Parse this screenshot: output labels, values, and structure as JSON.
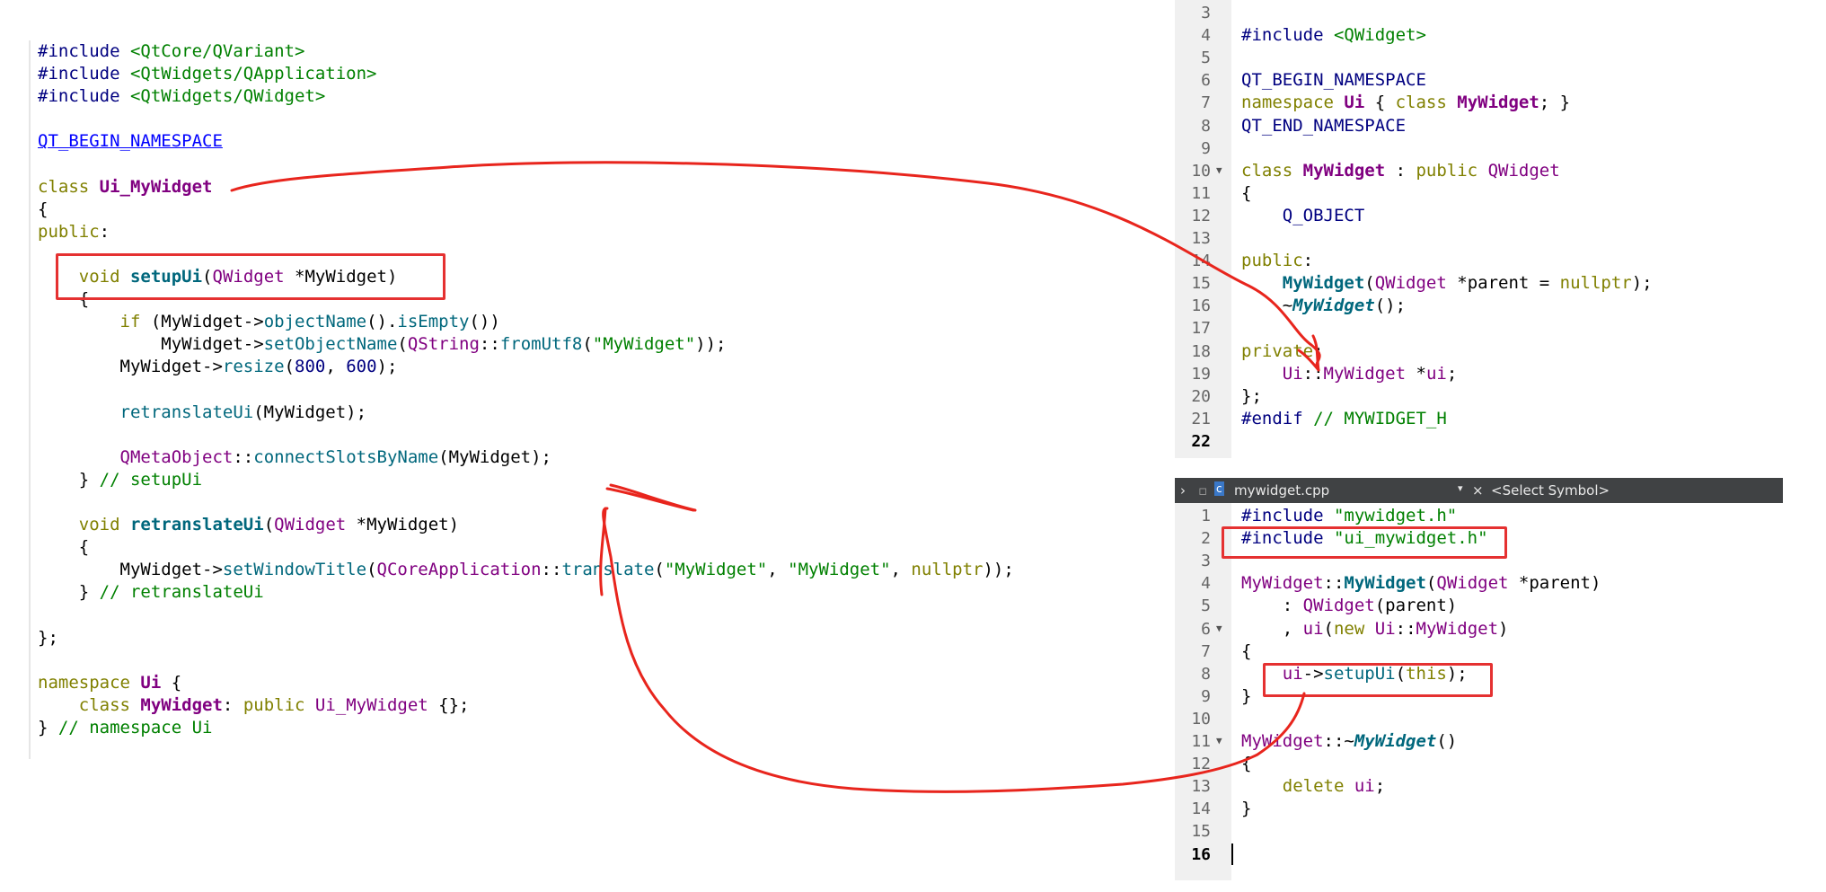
{
  "left_code": [
    [
      [
        "pp",
        "#include "
      ],
      [
        "str",
        "<QtCore/QVariant>"
      ]
    ],
    [
      [
        "pp",
        "#include "
      ],
      [
        "str",
        "<QtWidgets/QApplication>"
      ]
    ],
    [
      [
        "pp",
        "#include "
      ],
      [
        "str",
        "<QtWidgets/QWidget>"
      ]
    ],
    [],
    [
      [
        "link",
        "QT_BEGIN_NAMESPACE"
      ]
    ],
    [],
    [
      [
        "kw",
        "class "
      ],
      [
        "cls",
        "Ui_MyWidget"
      ]
    ],
    [
      [
        "",
        "{"
      ]
    ],
    [
      [
        "kw",
        "public"
      ],
      [
        "",
        ":"
      ]
    ],
    [],
    [
      [
        "",
        "    "
      ],
      [
        "kw",
        "void "
      ],
      [
        "def",
        "setupUi"
      ],
      [
        "",
        "("
      ],
      [
        "typ",
        "QWidget"
      ],
      [
        "",
        " *MyWidget)"
      ]
    ],
    [
      [
        "",
        "    {"
      ]
    ],
    [
      [
        "",
        "        "
      ],
      [
        "kw",
        "if "
      ],
      [
        "",
        "(MyWidget->"
      ],
      [
        "fn",
        "objectName"
      ],
      [
        "",
        "()."
      ],
      [
        "fn",
        "isEmpty"
      ],
      [
        "",
        "())"
      ]
    ],
    [
      [
        "",
        "            MyWidget->"
      ],
      [
        "fn",
        "setObjectName"
      ],
      [
        "",
        "("
      ],
      [
        "typ",
        "QString"
      ],
      [
        "",
        "::"
      ],
      [
        "fn",
        "fromUtf8"
      ],
      [
        "",
        "("
      ],
      [
        "str",
        "\"MyWidget\""
      ],
      [
        "",
        "));"
      ]
    ],
    [
      [
        "",
        "        MyWidget->"
      ],
      [
        "fn",
        "resize"
      ],
      [
        "",
        "("
      ],
      [
        "num",
        "800"
      ],
      [
        "",
        ", "
      ],
      [
        "num",
        "600"
      ],
      [
        "",
        ");"
      ]
    ],
    [],
    [
      [
        "",
        "        "
      ],
      [
        "fn",
        "retranslateUi"
      ],
      [
        "",
        "(MyWidget);"
      ]
    ],
    [],
    [
      [
        "",
        "        "
      ],
      [
        "typ",
        "QMetaObject"
      ],
      [
        "",
        "::"
      ],
      [
        "fn",
        "connectSlotsByName"
      ],
      [
        "",
        "(MyWidget);"
      ]
    ],
    [
      [
        "",
        "    } "
      ],
      [
        "cmt",
        "// setupUi"
      ]
    ],
    [],
    [
      [
        "",
        "    "
      ],
      [
        "kw",
        "void "
      ],
      [
        "def",
        "retranslateUi"
      ],
      [
        "",
        "("
      ],
      [
        "typ",
        "QWidget"
      ],
      [
        "",
        " *MyWidget)"
      ]
    ],
    [
      [
        "",
        "    {"
      ]
    ],
    [
      [
        "",
        "        MyWidget->"
      ],
      [
        "fn",
        "setWindowTitle"
      ],
      [
        "",
        "("
      ],
      [
        "typ",
        "QCoreApplication"
      ],
      [
        "",
        "::"
      ],
      [
        "fn",
        "translate"
      ],
      [
        "",
        "("
      ],
      [
        "str",
        "\"MyWidget\""
      ],
      [
        "",
        ", "
      ],
      [
        "str",
        "\"MyWidget\""
      ],
      [
        "",
        ", "
      ],
      [
        "kw",
        "nullptr"
      ],
      [
        "",
        "));"
      ]
    ],
    [
      [
        "",
        "    } "
      ],
      [
        "cmt",
        "// retranslateUi"
      ]
    ],
    [],
    [
      [
        "",
        "};"
      ]
    ],
    [],
    [
      [
        "kw",
        "namespace "
      ],
      [
        "cls",
        "Ui"
      ],
      [
        "",
        " {"
      ]
    ],
    [
      [
        "",
        "    "
      ],
      [
        "kw",
        "class "
      ],
      [
        "cls",
        "MyWidget"
      ],
      [
        "",
        ": "
      ],
      [
        "kw",
        "public "
      ],
      [
        "typ",
        "Ui_MyWidget"
      ],
      [
        "",
        " {};"
      ]
    ],
    [
      [
        "",
        "} "
      ],
      [
        "cmt",
        "// namespace Ui"
      ]
    ]
  ],
  "header_pane": {
    "line_numbers": [
      "3",
      "4",
      "5",
      "6",
      "7",
      "8",
      "9",
      "10",
      "11",
      "12",
      "13",
      "14",
      "15",
      "16",
      "17",
      "18",
      "19",
      "20",
      "21",
      "22"
    ],
    "fold_lines": [
      "10"
    ],
    "current_line": "22",
    "lines": [
      [],
      [
        [
          "pp",
          "#include "
        ],
        [
          "str",
          "<QWidget>"
        ]
      ],
      [],
      [
        [
          "pp",
          "QT_BEGIN_NAMESPACE"
        ]
      ],
      [
        [
          "kw",
          "namespace "
        ],
        [
          "cls",
          "Ui"
        ],
        [
          "",
          " { "
        ],
        [
          "kw",
          "class "
        ],
        [
          "cls",
          "MyWidget"
        ],
        [
          "",
          "; }"
        ]
      ],
      [
        [
          "pp",
          "QT_END_NAMESPACE"
        ]
      ],
      [],
      [
        [
          "kw",
          "class "
        ],
        [
          "cls",
          "MyWidget"
        ],
        [
          "",
          " : "
        ],
        [
          "kw",
          "public "
        ],
        [
          "typ",
          "QWidget"
        ]
      ],
      [
        [
          "",
          "{"
        ]
      ],
      [
        [
          "",
          "    "
        ],
        [
          "pp",
          "Q_OBJECT"
        ]
      ],
      [],
      [
        [
          "kw",
          "public"
        ],
        [
          "",
          ":"
        ]
      ],
      [
        [
          "",
          "    "
        ],
        [
          "def",
          "MyWidget"
        ],
        [
          "",
          "("
        ],
        [
          "typ",
          "QWidget"
        ],
        [
          "",
          " *parent = "
        ],
        [
          "kw",
          "nullptr"
        ],
        [
          "",
          ");"
        ]
      ],
      [
        [
          "",
          "    ~"
        ],
        [
          "ital",
          "MyWidget"
        ],
        [
          "",
          "();"
        ]
      ],
      [],
      [
        [
          "kw",
          "private"
        ],
        [
          "",
          ":"
        ]
      ],
      [
        [
          "",
          "    "
        ],
        [
          "typ",
          "Ui"
        ],
        [
          "",
          "::"
        ],
        [
          "typ",
          "MyWidget"
        ],
        [
          "",
          " *"
        ],
        [
          "typ",
          "ui"
        ],
        [
          "",
          ";"
        ]
      ],
      [
        [
          "",
          "};"
        ]
      ],
      [
        [
          "pp",
          "#endif "
        ],
        [
          "cmt",
          "// MYWIDGET_H"
        ]
      ],
      []
    ]
  },
  "cpp_tabbar": {
    "filename": "mywidget.cpp",
    "symbol": "<Select Symbol>"
  },
  "cpp_pane": {
    "line_numbers": [
      "1",
      "2",
      "3",
      "4",
      "5",
      "6",
      "7",
      "8",
      "9",
      "10",
      "11",
      "12",
      "13",
      "14",
      "15",
      "16"
    ],
    "fold_lines": [
      "6",
      "11"
    ],
    "current_line": "16",
    "lines": [
      [
        [
          "pp",
          "#include "
        ],
        [
          "str",
          "\"mywidget.h\""
        ]
      ],
      [
        [
          "pp",
          "#include "
        ],
        [
          "str",
          "\"ui_mywidget.h\""
        ]
      ],
      [],
      [
        [
          "typ",
          "MyWidget"
        ],
        [
          "",
          "::"
        ],
        [
          "def",
          "MyWidget"
        ],
        [
          "",
          "("
        ],
        [
          "typ",
          "QWidget"
        ],
        [
          "",
          " *parent)"
        ]
      ],
      [
        [
          "",
          "    : "
        ],
        [
          "typ",
          "QWidget"
        ],
        [
          "",
          "(parent)"
        ]
      ],
      [
        [
          "",
          "    , "
        ],
        [
          "typ",
          "ui"
        ],
        [
          "",
          "("
        ],
        [
          "kw",
          "new "
        ],
        [
          "typ",
          "Ui"
        ],
        [
          "",
          "::"
        ],
        [
          "typ",
          "MyWidget"
        ],
        [
          "",
          ")"
        ]
      ],
      [
        [
          "",
          "{"
        ]
      ],
      [
        [
          "",
          "    "
        ],
        [
          "typ",
          "ui"
        ],
        [
          "",
          "->"
        ],
        [
          "fn",
          "setupUi"
        ],
        [
          "",
          "("
        ],
        [
          "kw",
          "this"
        ],
        [
          "",
          ");"
        ]
      ],
      [
        [
          "",
          "}"
        ]
      ],
      [],
      [
        [
          "typ",
          "MyWidget"
        ],
        [
          "",
          "::~"
        ],
        [
          "ital",
          "MyWidget"
        ],
        [
          "",
          "()"
        ]
      ],
      [
        [
          "",
          "{"
        ]
      ],
      [
        [
          "",
          "    "
        ],
        [
          "kw",
          "delete "
        ],
        [
          "typ",
          "ui"
        ],
        [
          "",
          ";"
        ]
      ],
      [
        [
          "",
          "}"
        ]
      ],
      [],
      []
    ]
  },
  "colors": {
    "annotation": "#e53131",
    "keyword": "#808000",
    "type": "#800080",
    "function": "#00677c",
    "string": "#008000"
  }
}
